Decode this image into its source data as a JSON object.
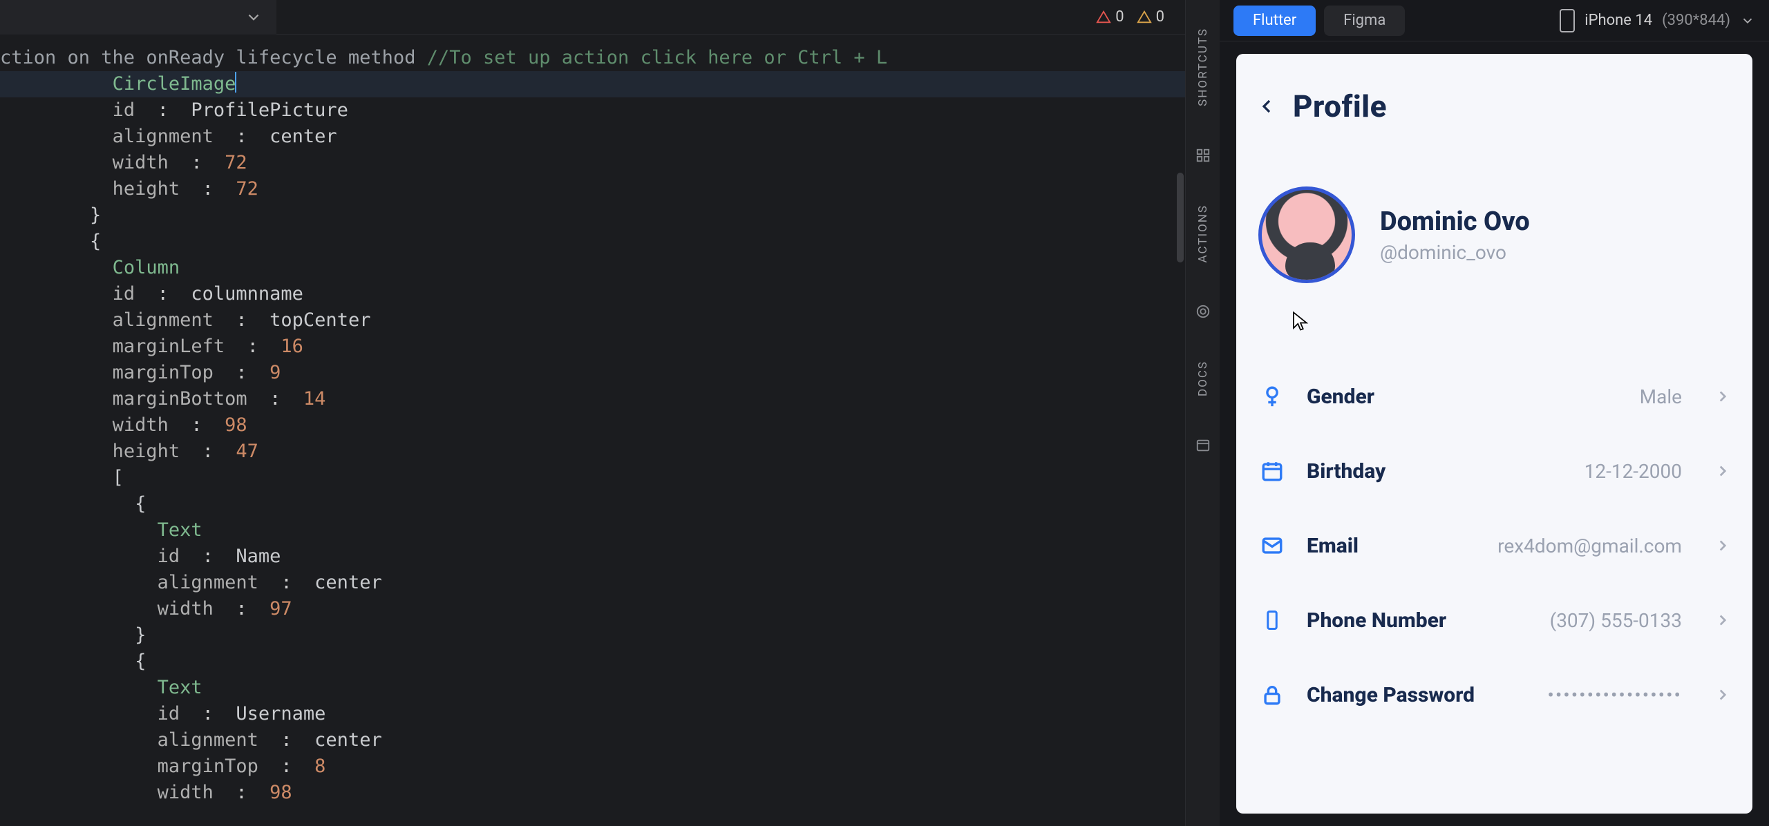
{
  "errors": {
    "err_count": "0",
    "warn_count": "0"
  },
  "preview": {
    "flutter_label": "Flutter",
    "figma_label": "Figma",
    "device_name": "iPhone 14",
    "device_res": "(390*844)"
  },
  "sideRail": {
    "shortcuts": "SHORTCUTS",
    "actions": "ACTIONS",
    "docs": "DOCS"
  },
  "code": {
    "l1a": "ction on the onReady lifecycle method ",
    "l1b": "//To set up action click here or Ctrl + L",
    "l2_type": "CircleImage",
    "l3_k": "id",
    "l3_v": "ProfilePicture",
    "l4_k": "alignment",
    "l4_v": "center",
    "l5_k": "width",
    "l5_v": "72",
    "l6_k": "height",
    "l6_v": "72",
    "l7": "}",
    "l8": "{",
    "l9_type": "Column",
    "l10_k": "id",
    "l10_v": "columnname",
    "l11_k": "alignment",
    "l11_v": "topCenter",
    "l12_k": "marginLeft",
    "l12_v": "16",
    "l13_k": "marginTop",
    "l13_v": "9",
    "l14_k": "marginBottom",
    "l14_v": "14",
    "l15_k": "width",
    "l15_v": "98",
    "l16_k": "height",
    "l16_v": "47",
    "l17": "[",
    "l18": "{",
    "l19_type": "Text",
    "l20_k": "id",
    "l20_v": "Name",
    "l21_k": "alignment",
    "l21_v": "center",
    "l22_k": "width",
    "l22_v": "97",
    "l23": "}",
    "l24": "{",
    "l25_type": "Text",
    "l26_k": "id",
    "l26_v": "Username",
    "l27_k": "alignment",
    "l27_v": "center",
    "l28_k": "marginTop",
    "l28_v": "8",
    "l29_k": "width",
    "l29_v": "98"
  },
  "profile": {
    "title": "Profile",
    "name": "Dominic Ovo",
    "handle": "@dominic_ovo",
    "rows": {
      "gender_label": "Gender",
      "gender_val": "Male",
      "birthday_label": "Birthday",
      "birthday_val": "12-12-2000",
      "email_label": "Email",
      "email_val": "rex4dom@gmail.com",
      "phone_label": "Phone Number",
      "phone_val": "(307) 555-0133",
      "pwd_label": "Change Password",
      "pwd_val": "•••••••••••••••••"
    }
  }
}
